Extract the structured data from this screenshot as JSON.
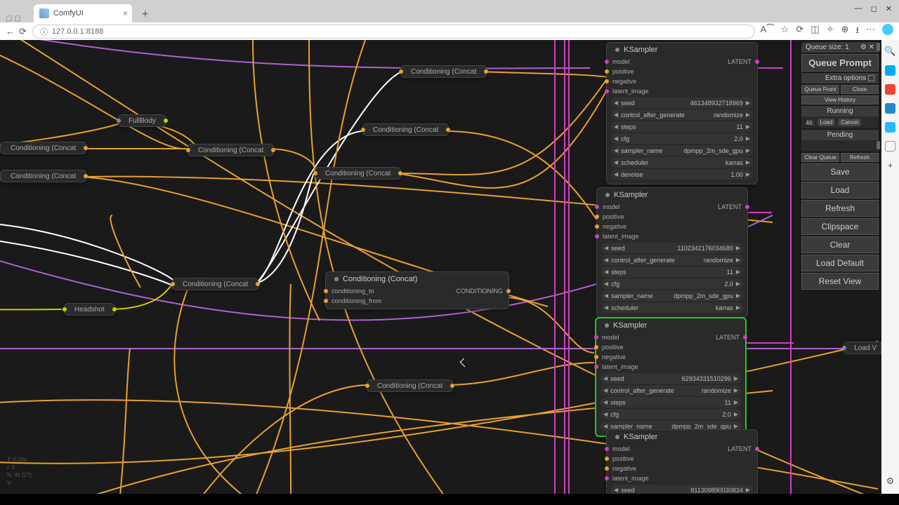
{
  "browser": {
    "tab_title": "ComfyUI",
    "url": "127.0.0.1:8188"
  },
  "menu": {
    "queue_size_label": "Queue size:",
    "queue_size": "1",
    "queue_prompt": "Queue Prompt",
    "extra_options": "Extra options",
    "queue_front": "Queue Front",
    "close": "Close",
    "view_history": "View History",
    "running": "Running",
    "running_id": "46:",
    "load_chip": "Load",
    "cancel_chip": "Cancel",
    "pending": "Pending",
    "clear_queue": "Clear Queue",
    "refresh_q": "Refresh",
    "save": "Save",
    "load": "Load",
    "refresh": "Refresh",
    "clipspace": "Clipspace",
    "clear": "Clear",
    "load_default": "Load Default",
    "reset_view": "Reset View"
  },
  "nodes": {
    "fullbody": "FullBody",
    "headshot": "Headshot",
    "concat": "Conditioning (Concat",
    "concat_full": "Conditioning (Concat)",
    "ksampler": "KSampler",
    "load_v": "Load V"
  },
  "ports": {
    "model": "model",
    "positive": "positive",
    "negative": "negative",
    "latent_image": "latent_image",
    "latent_out": "LATENT",
    "conditioning_to": "conditioning_to",
    "conditioning_from": "conditioning_from",
    "conditioning_out": "CONDITIONING"
  },
  "params": {
    "seed": "seed",
    "control_after_generate": "control_after_generate",
    "steps": "steps",
    "cfg": "cfg",
    "sampler_name": "sampler_name",
    "scheduler": "scheduler",
    "denoise": "denoise"
  },
  "ks1": {
    "seed": "461348932718969",
    "cag": "randomize",
    "steps": "11",
    "cfg": "2.0",
    "sampler": "dpmpp_2m_sde_gpu",
    "scheduler": "karras",
    "denoise": "1.00"
  },
  "ks2": {
    "seed": "110234217603468",
    "seed_suffix": "0",
    "cag": "randomize",
    "steps": "11",
    "cfg": "2.0",
    "sampler": "dpmpp_2m_sde_gpu",
    "scheduler": "karras"
  },
  "ks3": {
    "seed": "629343315102",
    "seed_suffix": "96",
    "cag": "randomize",
    "steps": "11",
    "cfg": "2.0",
    "sampler": "dpmpp_2m_sde_gpu"
  },
  "ks4": {
    "seed": "81",
    "seed_suffix": "1309890030834"
  },
  "debug": {
    "l1": "T: 0.00s",
    "l2": "I: 0",
    "l3": "N: 45 [27]",
    "l4": "V: "
  }
}
